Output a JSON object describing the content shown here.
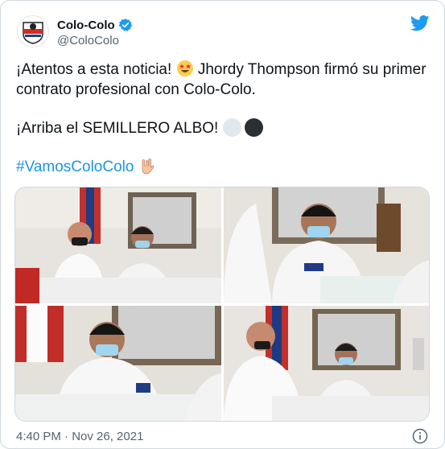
{
  "account": {
    "display_name": "Colo-Colo",
    "handle": "@ColoColo",
    "verified": true,
    "avatar_icon": "colo-colo-crest"
  },
  "tweet": {
    "line1": "¡Atentos a esta noticia! ",
    "line1_emoji": "star-struck",
    "line1_rest": " Jhordy Thompson firmó su primer contrato profesional con Colo-Colo.",
    "line2": "¡Arriba el SEMILLERO ALBO! ",
    "line2_emojis": [
      "white-circle",
      "black-circle"
    ],
    "hashtag": "#VamosColoColo",
    "hashtag_emoji": "love-you-gesture"
  },
  "media": {
    "count": 4,
    "photos": [
      "photo-1",
      "photo-2",
      "photo-3",
      "photo-4"
    ]
  },
  "footer": {
    "timestamp": "4:40 PM · Nov 26, 2021"
  },
  "colors": {
    "brand": "#1d9bf0",
    "hashtag": "#1b95e0",
    "text": "#0f1419",
    "secondary": "#536471"
  }
}
